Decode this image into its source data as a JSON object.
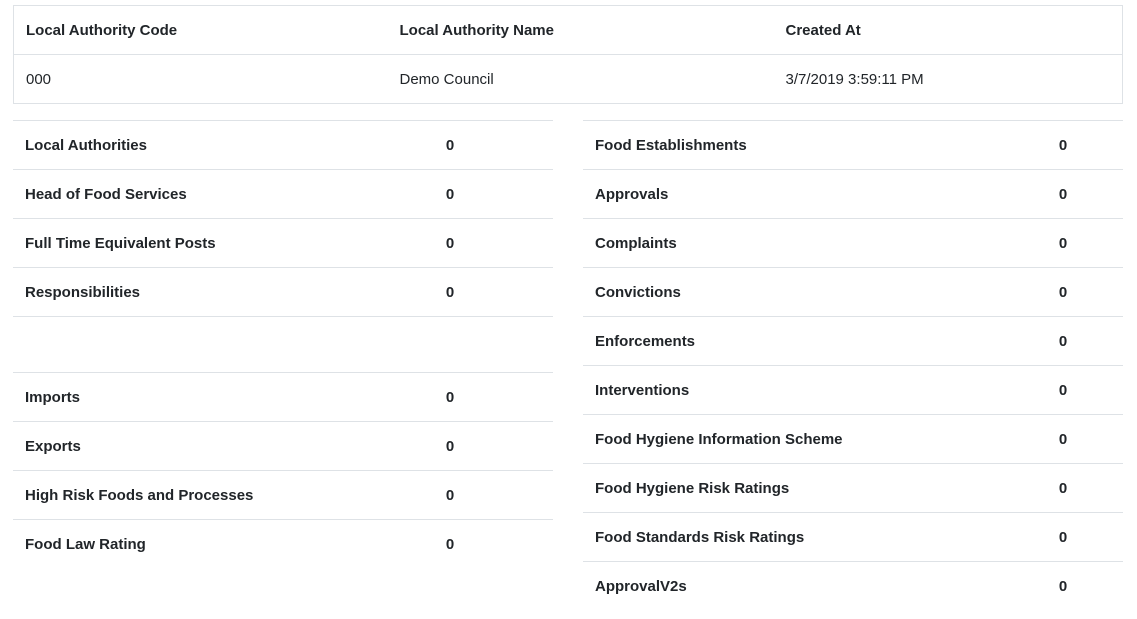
{
  "authority_table": {
    "headers": [
      "Local Authority Code",
      "Local Authority Name",
      "Created At"
    ],
    "row": {
      "code": "000",
      "name": "Demo Council",
      "created_at": "3/7/2019 3:59:11 PM"
    }
  },
  "left_stats": {
    "group1": [
      {
        "label": "Local Authorities",
        "value": "0"
      },
      {
        "label": "Head of Food Services",
        "value": "0"
      },
      {
        "label": "Full Time Equivalent Posts",
        "value": "0"
      },
      {
        "label": "Responsibilities",
        "value": "0"
      }
    ],
    "group2": [
      {
        "label": "Imports",
        "value": "0"
      },
      {
        "label": "Exports",
        "value": "0"
      },
      {
        "label": "High Risk Foods and Processes",
        "value": "0"
      },
      {
        "label": "Food Law Rating",
        "value": "0"
      }
    ]
  },
  "right_stats": [
    {
      "label": "Food Establishments",
      "value": "0"
    },
    {
      "label": "Approvals",
      "value": "0"
    },
    {
      "label": "Complaints",
      "value": "0"
    },
    {
      "label": "Convictions",
      "value": "0"
    },
    {
      "label": "Enforcements",
      "value": "0"
    },
    {
      "label": "Interventions",
      "value": "0"
    },
    {
      "label": "Food Hygiene Information Scheme",
      "value": "0"
    },
    {
      "label": "Food Hygiene Risk Ratings",
      "value": "0"
    },
    {
      "label": "Food Standards Risk Ratings",
      "value": "0"
    },
    {
      "label": "ApprovalV2s",
      "value": "0"
    }
  ]
}
